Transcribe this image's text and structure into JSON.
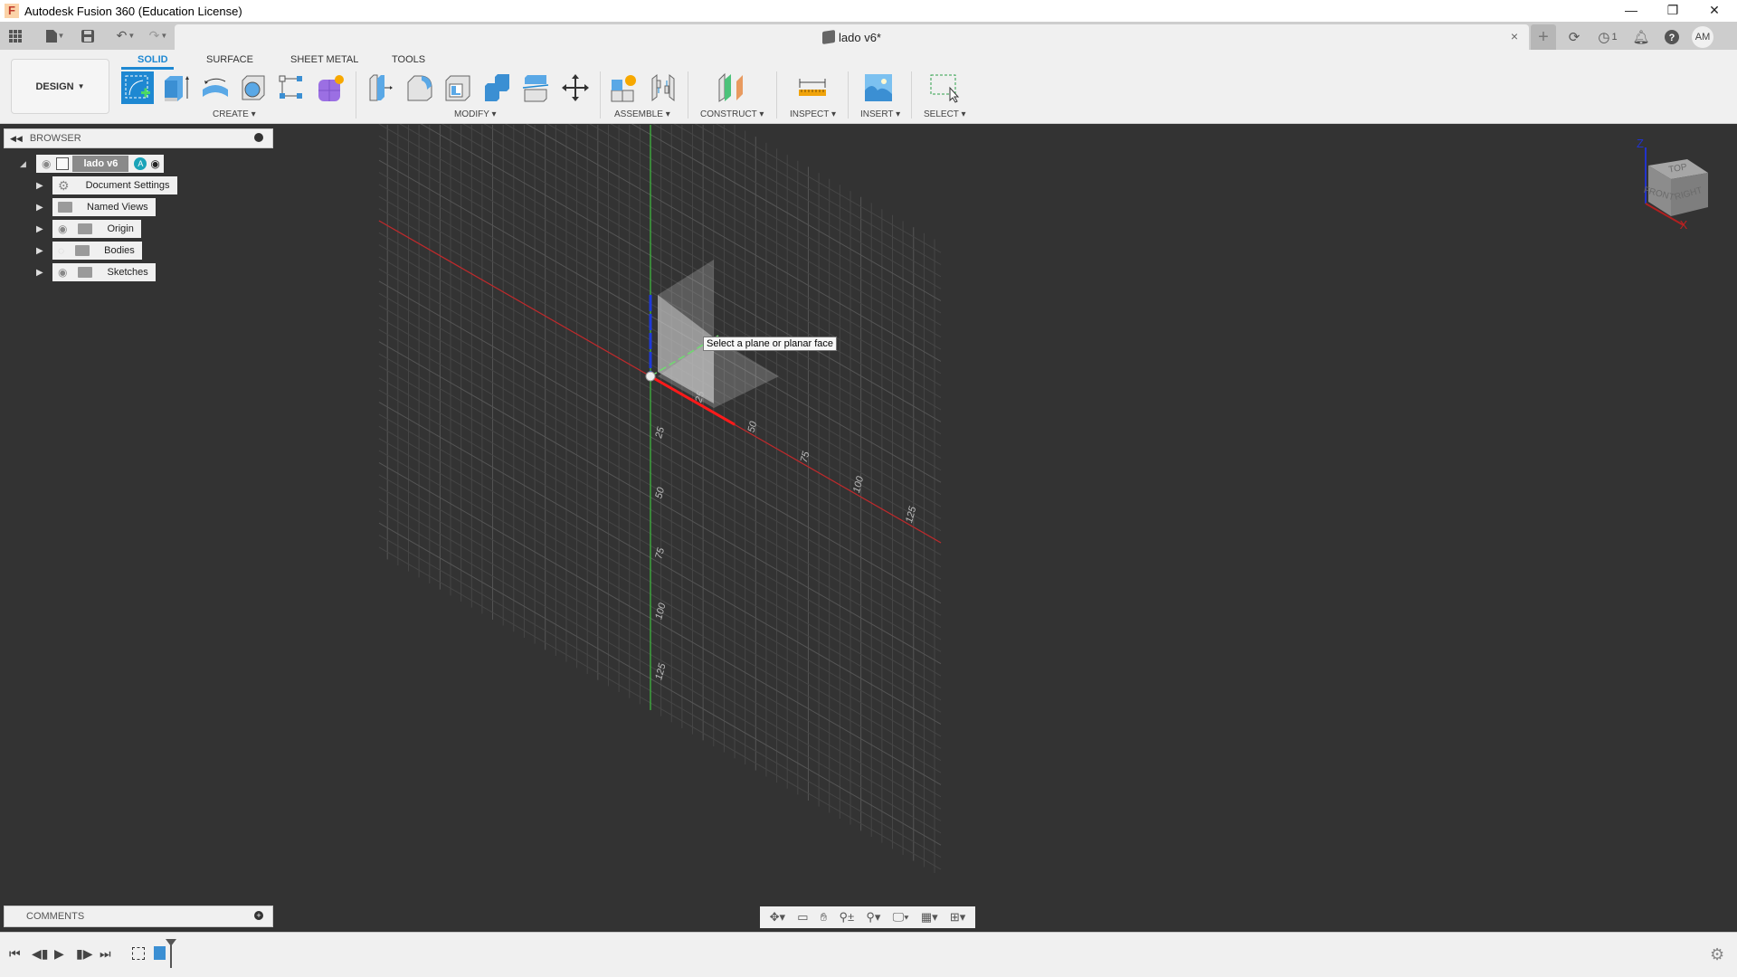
{
  "window": {
    "title": "Autodesk Fusion 360 (Education License)",
    "logo_letter": "F",
    "minimize": "—",
    "restore": "❐",
    "close": "✕"
  },
  "tabstrip": {
    "document_name": "lado v6*",
    "close": "×",
    "new_tab": "+",
    "job_count": "1",
    "user_initials": "AM"
  },
  "toolbar": {
    "workspace": "DESIGN",
    "tabs": [
      "SOLID",
      "SURFACE",
      "SHEET METAL",
      "TOOLS"
    ],
    "active_tab": "SOLID",
    "groups": {
      "create": "CREATE",
      "modify": "MODIFY",
      "assemble": "ASSEMBLE",
      "construct": "CONSTRUCT",
      "inspect": "INSPECT",
      "insert": "INSERT",
      "select": "SELECT"
    },
    "caret": "▾"
  },
  "browser": {
    "title": "BROWSER",
    "root": "lado v6",
    "items": [
      {
        "label": "Document Settings",
        "icon": "gear-icon",
        "eye": false
      },
      {
        "label": "Named Views",
        "icon": "folder-icon",
        "eye": false
      },
      {
        "label": "Origin",
        "icon": "folder-icon",
        "eye": true
      },
      {
        "label": "Bodies",
        "icon": "folder-icon",
        "eye": "hidden"
      },
      {
        "label": "Sketches",
        "icon": "folder-icon",
        "eye": true
      }
    ]
  },
  "viewport": {
    "tooltip": "Select a plane or planar face",
    "x_axis_ticks": [
      "25",
      "50",
      "75",
      "100",
      "125"
    ],
    "y_axis_ticks": [
      "25",
      "50",
      "75",
      "100",
      "125"
    ],
    "viewcube": {
      "top": "TOP",
      "front": "FRONT",
      "right": "RIGHT",
      "z": "Z",
      "x": "X"
    },
    "colors": {
      "x_axis": "#c0282a",
      "y_axis": "#3fbf3f",
      "z_axis": "#1e3adb",
      "grid": "#4a4a4a",
      "background": "#333333"
    }
  },
  "comments": {
    "title": "COMMENTS"
  }
}
